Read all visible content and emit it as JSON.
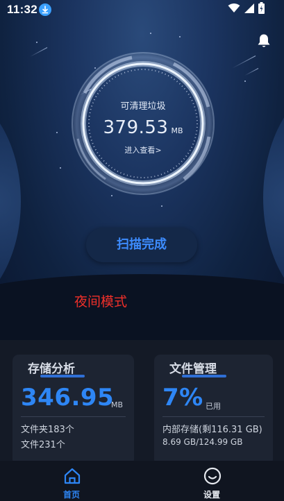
{
  "status_bar": {
    "time": "11:32"
  },
  "colors": {
    "accent": "#2e86f5",
    "night_mode_text": "#f0302a",
    "background_top": "#1b3460",
    "card_bg": "#1d2432"
  },
  "gauge": {
    "label": "可清理垃圾",
    "value": "379.53",
    "unit": "MB",
    "link": "进入查看>"
  },
  "scan_button": {
    "label": "扫描完成"
  },
  "night_mode": {
    "label": "夜间模式"
  },
  "cards": {
    "storage": {
      "title": "存储分析",
      "value": "346.95",
      "unit": "MB",
      "line1": "文件夹183个",
      "line2": "文件231个"
    },
    "files": {
      "title": "文件管理",
      "value": "7%",
      "unit": "已用",
      "line1": "内部存储(剩116.31 GB)",
      "line2": "8.69 GB/124.99 GB"
    }
  },
  "nav": {
    "items": [
      {
        "label": "首页",
        "icon": "home-icon",
        "active": true
      },
      {
        "label": "设置",
        "icon": "settings-face-icon",
        "active": false
      }
    ]
  }
}
